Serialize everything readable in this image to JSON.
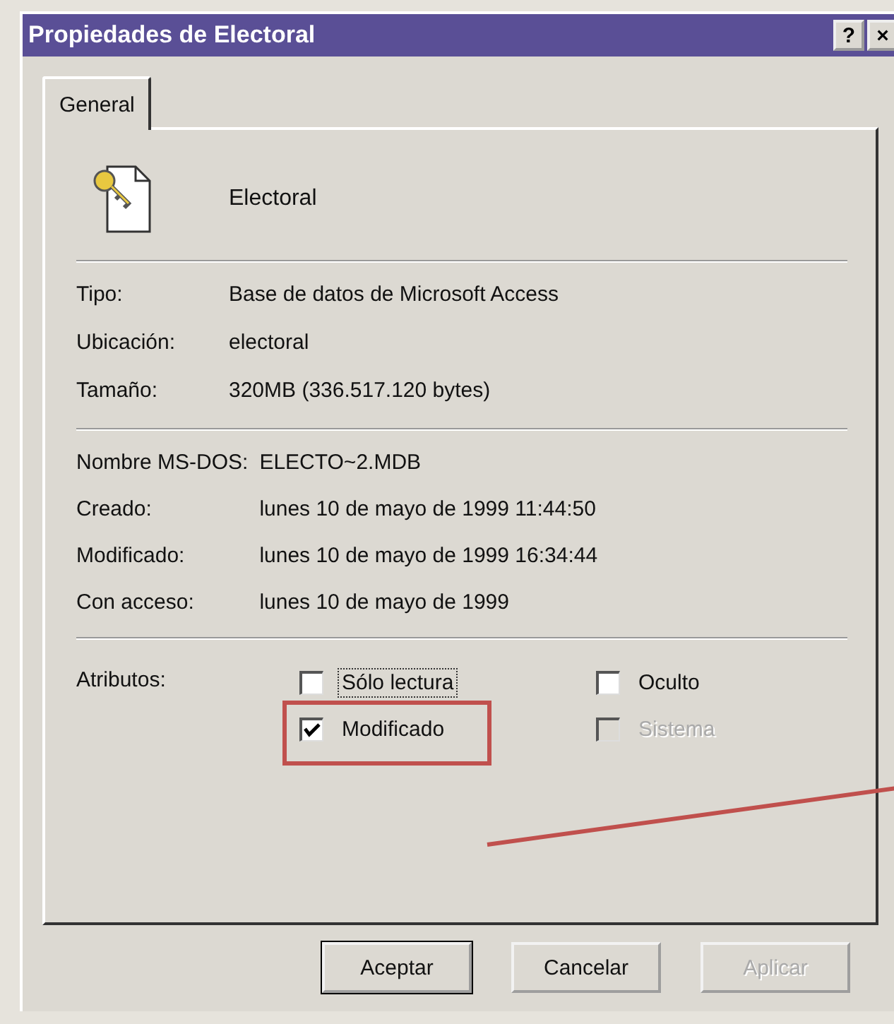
{
  "window": {
    "title": "Propiedades de Electoral",
    "help_button": "?",
    "close_button": "×"
  },
  "tabs": [
    {
      "label": "General",
      "selected": true
    }
  ],
  "file": {
    "name": "Electoral"
  },
  "details": [
    {
      "label": "Tipo:",
      "value": "Base de datos de Microsoft Access"
    },
    {
      "label": "Ubicación:",
      "value": "electoral"
    },
    {
      "label": "Tamaño:",
      "value": "320MB (336.517.120 bytes)"
    }
  ],
  "dates": [
    {
      "label": "Nombre MS-DOS:",
      "value": "ELECTO~2.MDB"
    },
    {
      "label": "Creado:",
      "value": "lunes 10 de mayo de 1999 11:44:50"
    },
    {
      "label": "Modificado:",
      "value": "lunes 10 de mayo de 1999 16:34:44"
    },
    {
      "label": "Con acceso:",
      "value": "lunes 10 de mayo de 1999"
    }
  ],
  "attributes": {
    "label": "Atributos:",
    "items": [
      {
        "label": "Sólo lectura",
        "checked": false,
        "disabled": false,
        "focused": true
      },
      {
        "label": "Oculto",
        "checked": false,
        "disabled": false,
        "focused": false
      },
      {
        "label": "Modificado",
        "checked": true,
        "disabled": false,
        "focused": false,
        "highlighted": true
      },
      {
        "label": "Sistema",
        "checked": false,
        "disabled": true,
        "focused": false
      }
    ]
  },
  "buttons": [
    {
      "label": "Aceptar",
      "default": true,
      "disabled": false
    },
    {
      "label": "Cancelar",
      "default": false,
      "disabled": false
    },
    {
      "label": "Aplicar",
      "default": false,
      "disabled": true
    }
  ]
}
